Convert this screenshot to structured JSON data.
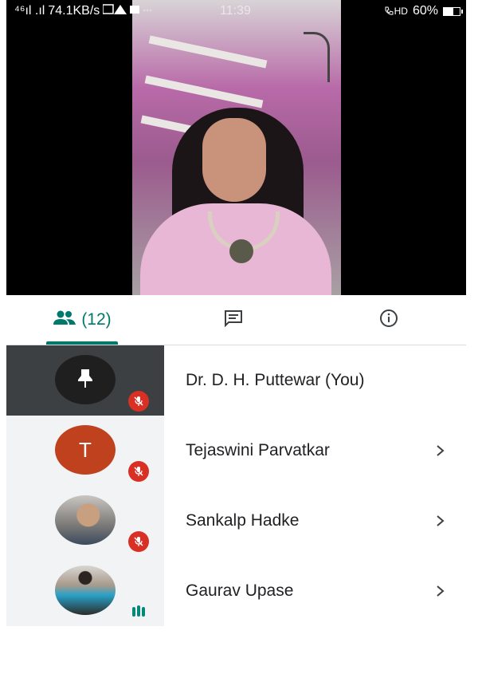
{
  "status_bar": {
    "signal": "⁴⁶ıl .ıl",
    "speed": "74.1KB/s",
    "time": "11:39",
    "hd_call": "HD",
    "battery": "60%"
  },
  "tabs": {
    "people_count": "(12)"
  },
  "participants": [
    {
      "name": "Dr. D. H. Puttewar (You)",
      "avatar": "pin-icon",
      "state": "muted"
    },
    {
      "name": "Tejaswini Parvatkar",
      "avatar_letter": "T",
      "state": "muted"
    },
    {
      "name": "Sankalp Hadke",
      "avatar": "photo",
      "state": "muted"
    },
    {
      "name": "Gaurav Upase",
      "avatar": "photo",
      "state": "speaking"
    }
  ],
  "colors": {
    "accent": "#00796b",
    "mute_red": "#d93025",
    "avatar_orange": "#c0411e"
  }
}
